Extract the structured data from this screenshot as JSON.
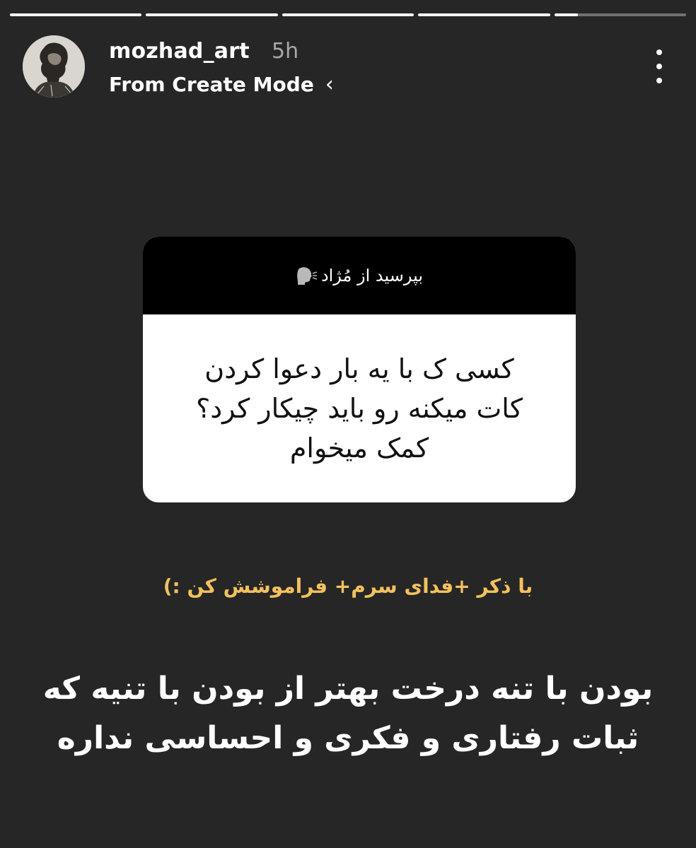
{
  "story": {
    "progress": [
      1,
      1,
      1,
      1,
      0.18
    ]
  },
  "header": {
    "username": "mozhad_art",
    "time": "5h",
    "subtitle": "From Create Mode",
    "chevron": "‹",
    "more_icon": "vertical-ellipsis-icon",
    "avatar_icon": "profile-avatar-icon"
  },
  "question_card": {
    "prompt": "بپرسید از مُژاد",
    "prompt_icon": "speaking-head-icon",
    "question_lines": [
      "کسی ک با یه بار دعوا کردن",
      "کات میکنه رو باید چیکار کرد؟",
      "کمک میخوام"
    ]
  },
  "answer": {
    "small": "با ذکر +فدای سرم+ فراموشش کن :)",
    "big_lines": [
      "بودن با تنه درخت بهتر از بودن با تنیه که",
      "ثبات رفتاری و فکری و احساسی نداره"
    ]
  },
  "colors": {
    "background": "#262626",
    "accent_text": "#f4c15d",
    "card_header": "#000000",
    "card_body": "#ffffff"
  }
}
